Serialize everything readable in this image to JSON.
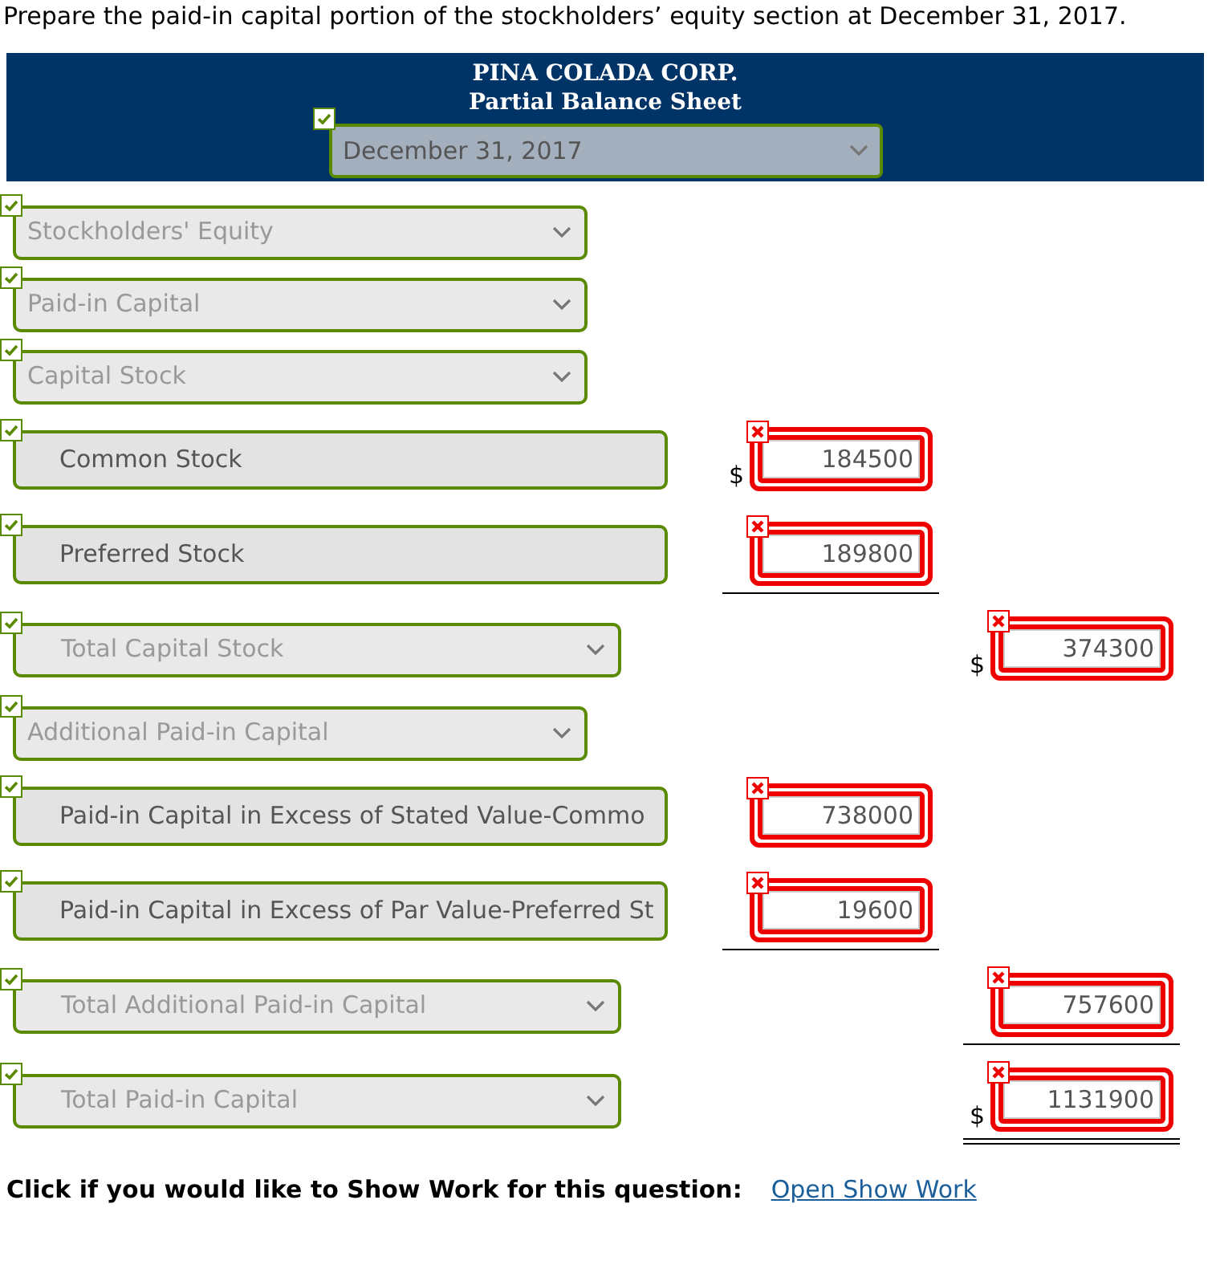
{
  "question": "Prepare the paid-in capital portion of the stockholders’ equity section at December 31, 2017.",
  "header": {
    "company": "PINA COLADA CORP.",
    "statement": "Partial Balance Sheet",
    "date": {
      "value": "December 31, 2017",
      "correct": true
    }
  },
  "rows": [
    {
      "kind": "select",
      "label": "Stockholders' Equity",
      "indented": false,
      "correct": true
    },
    {
      "kind": "select",
      "label": "Paid-in Capital",
      "indented": false,
      "correct": true
    },
    {
      "kind": "select",
      "label": "Capital Stock",
      "indented": false,
      "correct": true
    },
    {
      "kind": "text",
      "label": "Common Stock",
      "correct": true,
      "amount": {
        "currency": "$",
        "value": "184500",
        "correct": false
      }
    },
    {
      "kind": "text",
      "label": "Preferred Stock",
      "correct": true,
      "amount": {
        "value": "189800",
        "correct": false,
        "underlined": true
      }
    },
    {
      "kind": "select",
      "label": "Total Capital Stock",
      "indented": true,
      "correct": true,
      "total": {
        "currency": "$",
        "value": "374300",
        "correct": false
      }
    },
    {
      "kind": "select",
      "label": "Additional Paid-in Capital",
      "indented": false,
      "correct": true
    },
    {
      "kind": "text",
      "label": "Paid-in Capital in Excess of Stated Value-Commo",
      "correct": true,
      "amount": {
        "value": "738000",
        "correct": false
      }
    },
    {
      "kind": "text",
      "label": "Paid-in Capital in Excess of Par Value-Preferred St",
      "correct": true,
      "amount": {
        "value": "19600",
        "correct": false,
        "underlined": true
      }
    },
    {
      "kind": "select",
      "label": "Total Additional Paid-in Capital",
      "indented": true,
      "correct": true,
      "total": {
        "value": "757600",
        "correct": false,
        "underlined": true
      }
    },
    {
      "kind": "select",
      "label": "Total Paid-in Capital",
      "indented": true,
      "correct": true,
      "total": {
        "currency": "$",
        "value": "1131900",
        "correct": false,
        "underlined": true,
        "double_underlined": true
      }
    }
  ],
  "footer": {
    "prompt": "Click if you would like to Show Work for this question:",
    "link": "Open Show Work"
  }
}
